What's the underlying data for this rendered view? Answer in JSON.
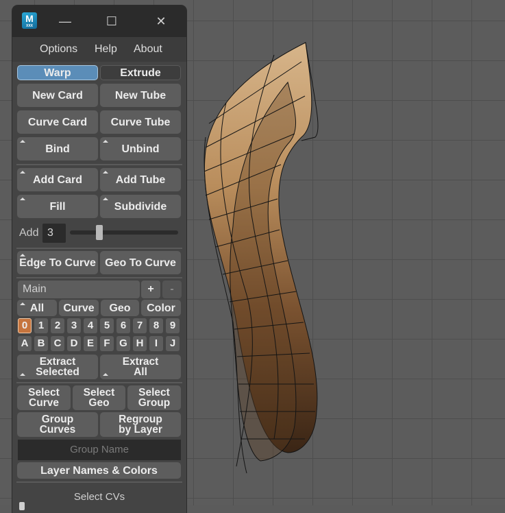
{
  "window": {
    "logo_letter": "M",
    "logo_sub": "XXX",
    "minimize_glyph": "—",
    "maximize_glyph": "☐",
    "close_glyph": "✕"
  },
  "menu": [
    "Options",
    "Help",
    "About"
  ],
  "mode": {
    "warp": "Warp",
    "extrude": "Extrude",
    "active": "Warp"
  },
  "create": {
    "new_card": "New Card",
    "new_tube": "New Tube",
    "curve_card": "Curve Card",
    "curve_tube": "Curve Tube",
    "bind": "Bind",
    "unbind": "Unbind"
  },
  "modify": {
    "add_card": "Add Card",
    "add_tube": "Add Tube",
    "fill": "Fill",
    "subdivide": "Subdivide",
    "add_label": "Add",
    "add_value": "3",
    "slider_fraction": 0.24
  },
  "convert": {
    "edge_to_curve": "Edge To Curve",
    "geo_to_curve": "Geo To Curve"
  },
  "layers": {
    "current": "Main",
    "plus": "+",
    "minus": "-",
    "filters": [
      "All",
      "Curve",
      "Geo",
      "Color"
    ],
    "numbers": [
      "0",
      "1",
      "2",
      "3",
      "4",
      "5",
      "6",
      "7",
      "8",
      "9"
    ],
    "letters": [
      "A",
      "B",
      "C",
      "D",
      "E",
      "F",
      "G",
      "H",
      "I",
      "J"
    ],
    "selected_number": "0",
    "extract_selected": [
      "Extract",
      "Selected"
    ],
    "extract_all": [
      "Extract",
      "All"
    ]
  },
  "selection": {
    "select_curve": [
      "Select",
      "Curve"
    ],
    "select_geo": [
      "Select",
      "Geo"
    ],
    "select_group": [
      "Select",
      "Group"
    ],
    "group_curves": [
      "Group",
      "Curves"
    ],
    "regroup_by_layer": [
      "Regroup",
      "by Layer"
    ],
    "group_name_placeholder": "Group Name",
    "layer_names_colors": "Layer Names & Colors"
  },
  "select_cvs": "Select CVs",
  "colors": {
    "active_button": "#5b8db8",
    "selected_layer": "#c6743d",
    "panel": "#444444",
    "viewport": "#5c5c5c"
  }
}
